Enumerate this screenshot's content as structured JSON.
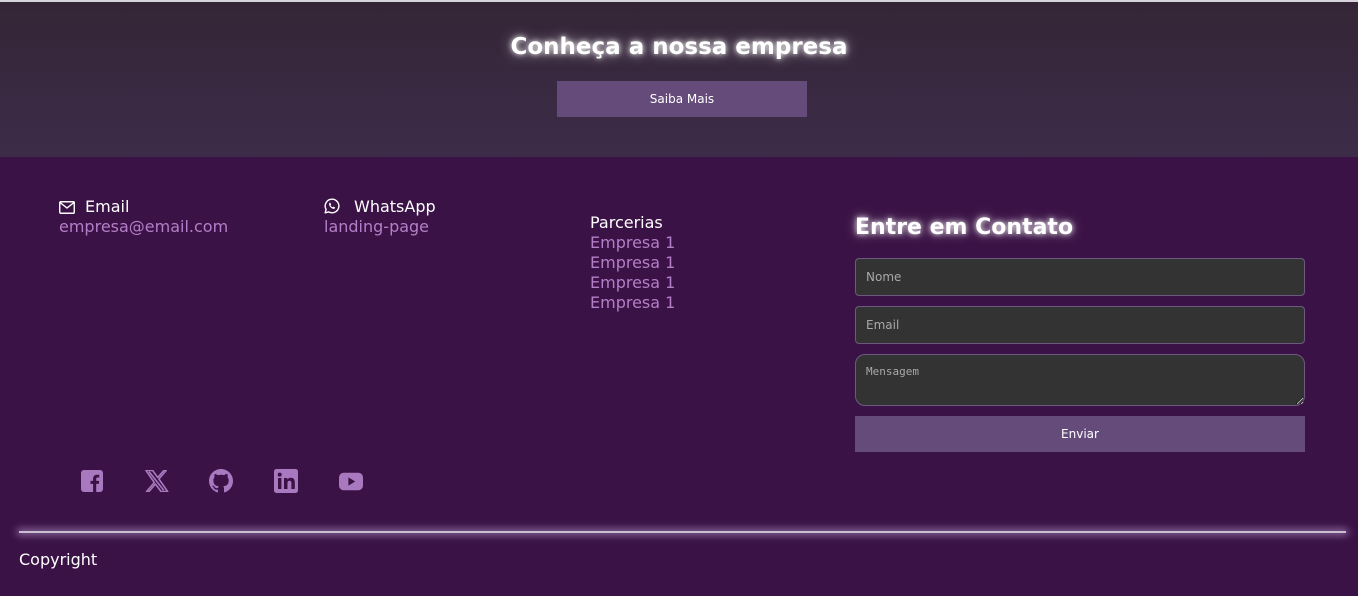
{
  "hero": {
    "title": "Conheça a nossa empresa",
    "button_label": "Saiba Mais"
  },
  "contacts": {
    "email": {
      "label": "Email",
      "value": "empresa@email.com",
      "icon": "envelope-icon"
    },
    "whatsapp": {
      "label": "WhatsApp",
      "value": "landing-page",
      "icon": "whatsapp-icon"
    }
  },
  "partners": {
    "label": "Parcerias",
    "items": [
      "Empresa 1",
      "Empresa 1",
      "Empresa 1",
      "Empresa 1"
    ]
  },
  "contact_form": {
    "title": "Entre em Contato",
    "name_placeholder": "Nome",
    "email_placeholder": "Email",
    "message_placeholder": "Mensagem",
    "submit_label": "Enviar"
  },
  "social": [
    "facebook-icon",
    "x-icon",
    "github-icon",
    "linkedin-icon",
    "youtube-icon"
  ],
  "footer": {
    "copyright": "Copyright"
  },
  "colors": {
    "background": "#3a1245",
    "hero_background": "#3a2a42",
    "button": "#654b7a",
    "link": "#b57ec8",
    "social_icon": "#a879be",
    "input_background": "#333333"
  }
}
